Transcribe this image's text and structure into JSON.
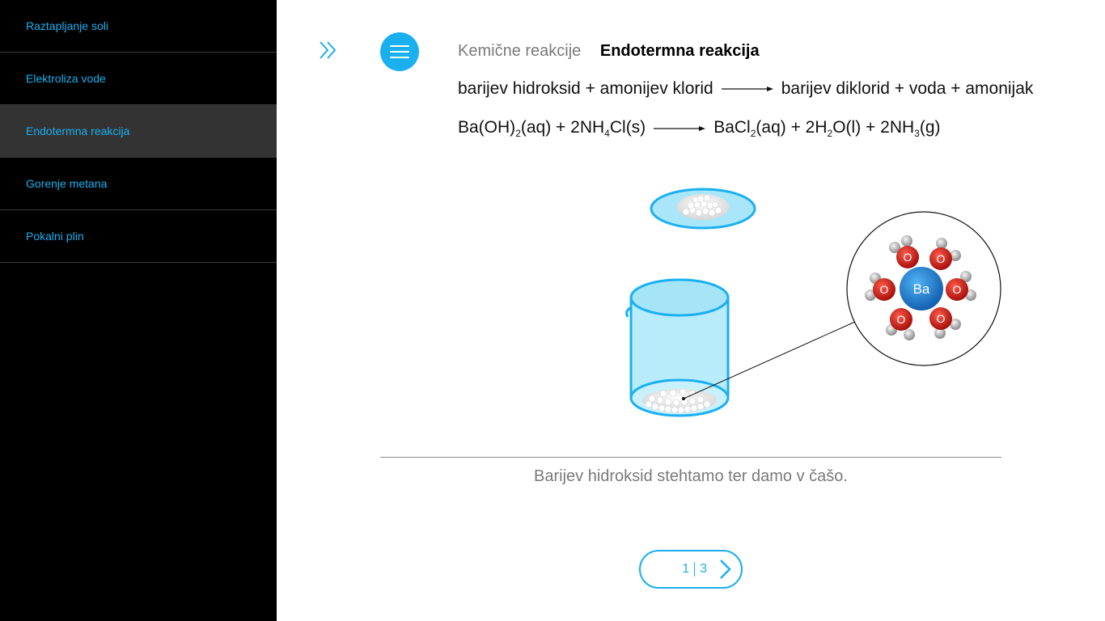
{
  "sidebar": {
    "items": [
      {
        "label": "Raztapljanje soli"
      },
      {
        "label": "Elektroliza vode"
      },
      {
        "label": "Endotermna reakcija"
      },
      {
        "label": "Gorenje metana"
      },
      {
        "label": "Pokalni plin"
      }
    ],
    "active_index": 2
  },
  "header": {
    "expand_icon": "double-chevron-right-icon",
    "menu_icon": "hamburger-menu-icon",
    "breadcrumb_parent": "Kemične reakcije",
    "breadcrumb_current": "Endotermna reakcija"
  },
  "equations": {
    "word_left": "barijev hidroksid + amonijev klorid",
    "word_right": "barijev diklorid + voda + amonijak",
    "formula_left": {
      "p1": "Ba(OH)",
      "s1": "2",
      "p2": "(aq) + 2NH",
      "s2": "4",
      "p3": "Cl(s)"
    },
    "formula_right": {
      "p1": "BaCl",
      "s1": "2",
      "p2": "(aq) + 2H",
      "s2": "2",
      "p3": "O(l) + 2NH",
      "s3": "3",
      "p4": "(g)"
    }
  },
  "illustration": {
    "atom_center_label": "Ba",
    "oxygen_label": "O"
  },
  "caption": "Barijev hidroksid stehtamo ter damo v čašo.",
  "pager": {
    "current": "1",
    "total": "3",
    "next_icon": "chevron-right-icon"
  },
  "colors": {
    "accent": "#1ab0f0",
    "sidebar_bg": "#000000",
    "sidebar_active_bg": "#333333",
    "oxygen": "#d0211b",
    "barium": "#1a7fd0"
  }
}
